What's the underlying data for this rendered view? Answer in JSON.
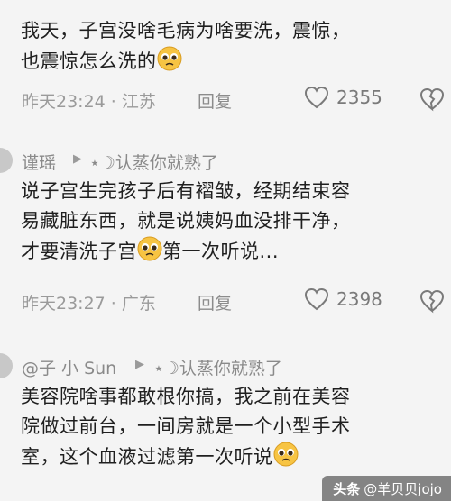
{
  "comments": [
    {
      "lines": [
        "我天，子宫没啥毛病为啥要洗，震惊，",
        "也震惊怎么洗的"
      ],
      "time": "昨天23:24 · 江苏",
      "reply_label": "回复",
      "likes": "2355"
    },
    {
      "author": "谨瑶",
      "reply_to": "⋆☽认蒸你就熟了",
      "lines": [
        "说子宫生完孩子后有褶皱，经期结束容",
        "易藏脏东西，就是说姨妈血没排干净，",
        "才要清洗子宫",
        "第一次听说..."
      ],
      "time": "昨天23:27 · 广东",
      "reply_label": "回复",
      "likes": "2398"
    },
    {
      "author": "@子 小 Sun",
      "reply_to": "⋆☽认蒸你就熟了",
      "lines": [
        "美容院啥事都敢根你搞，我之前在美容",
        "院做过前台，一间房就是一个小型手术",
        "室，这个血液过滤第一次听说"
      ]
    }
  ],
  "watermark": {
    "brand": "头条",
    "account": "@羊贝贝jojo"
  },
  "icons": {
    "emoji": "pleading-face-icon",
    "heart": "heart-outline-icon",
    "dislike": "broken-heart-icon"
  },
  "colors": {
    "background": "#f4f4f4",
    "meta": "#9a9a9a",
    "text": "#1f1f1f"
  }
}
